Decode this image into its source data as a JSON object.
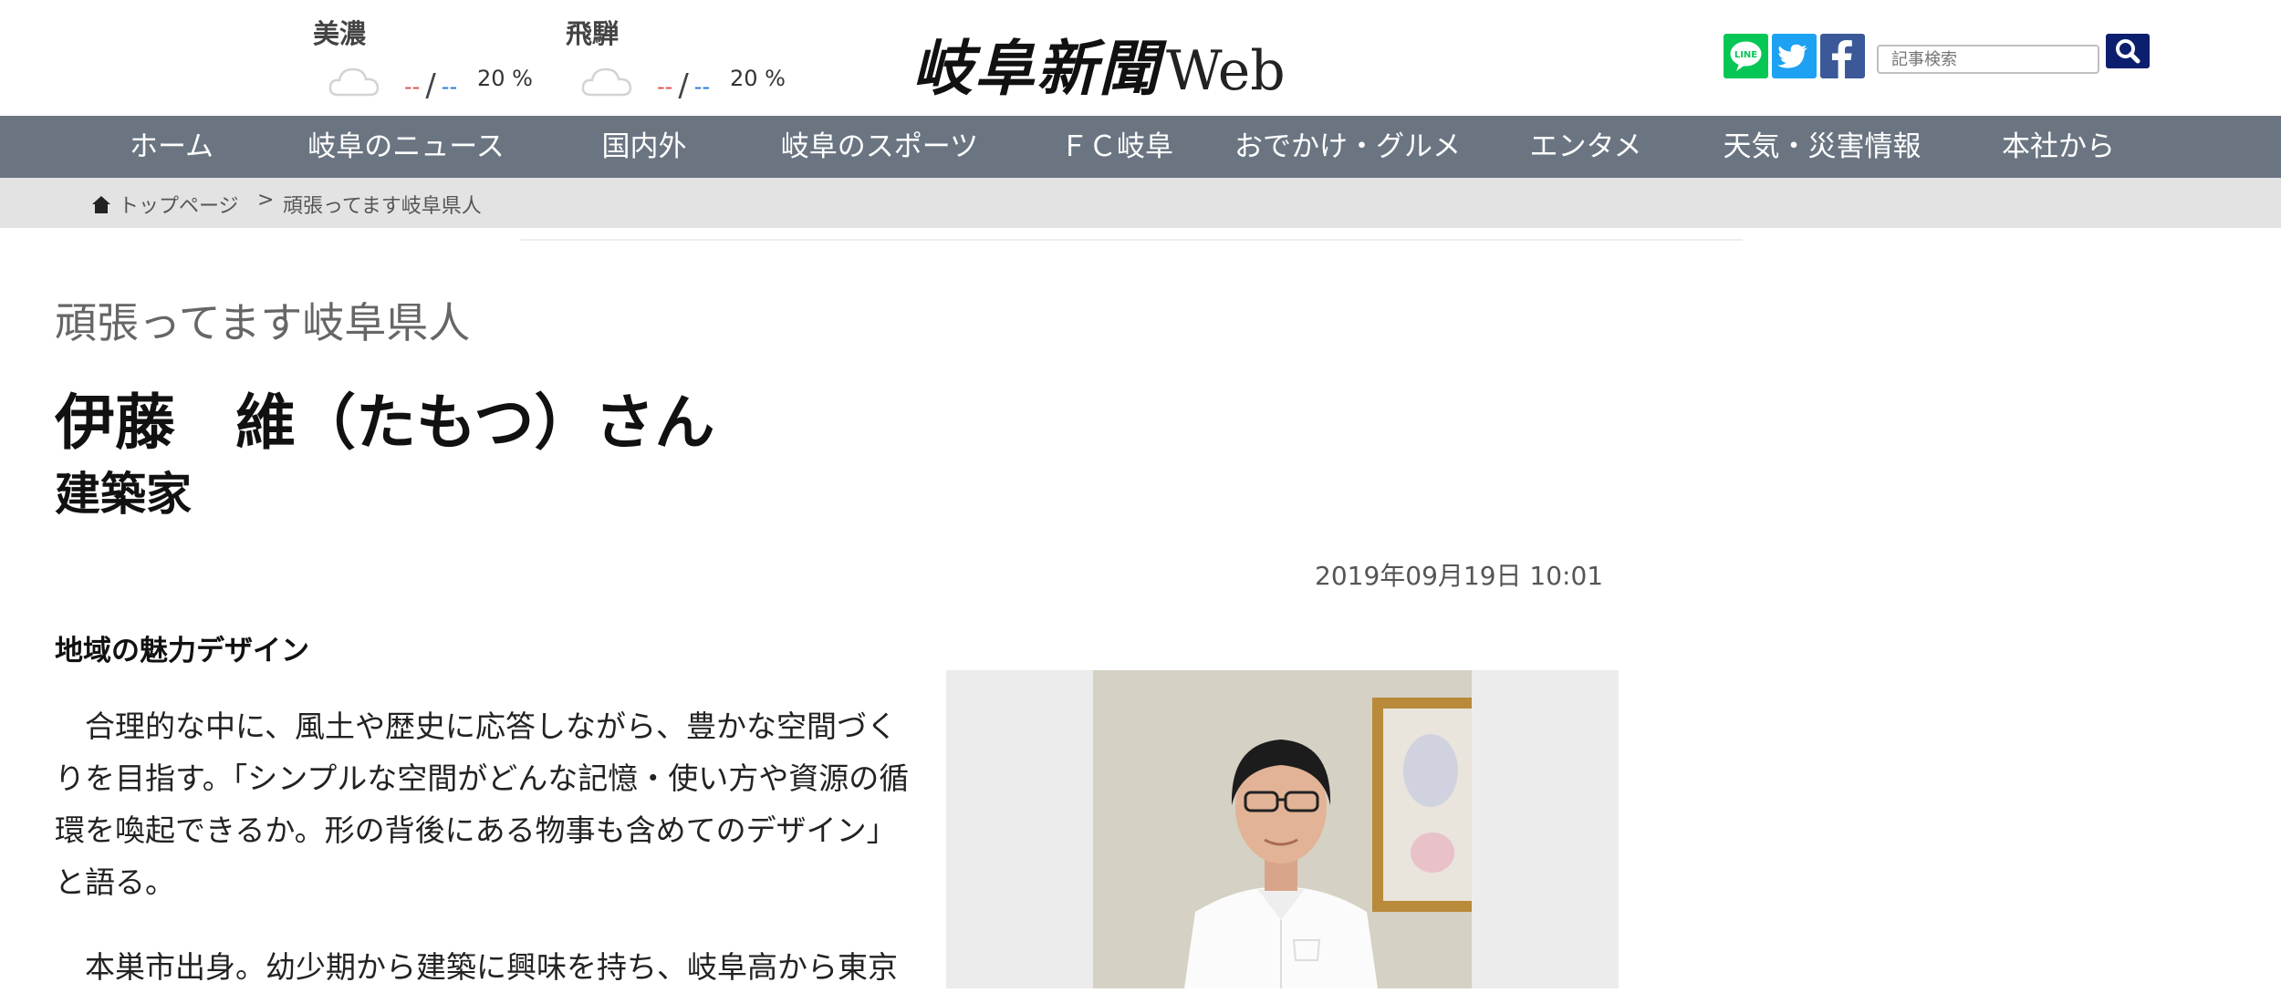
{
  "weather": [
    {
      "region": "美濃",
      "high": "--",
      "slash": "/",
      "low": "--",
      "rain": "20 %",
      "icon": "cloud-icon"
    },
    {
      "region": "飛騨",
      "high": "--",
      "slash": "/",
      "low": "--",
      "rain": "20 %",
      "icon": "cloud-icon"
    }
  ],
  "logo": {
    "main": "岐阜新聞",
    "suffix": "Web"
  },
  "sns": [
    {
      "name": "line-icon",
      "label": "LINE",
      "color": "#06c755"
    },
    {
      "name": "twitter-icon",
      "color": "#1da1f2"
    },
    {
      "name": "facebook-icon",
      "color": "#3b5998"
    }
  ],
  "search": {
    "placeholder": "記事検索",
    "button_icon": "search-icon",
    "button_color": "#0b1f6e"
  },
  "nav": [
    {
      "label": "ホーム"
    },
    {
      "label": "岐阜のニュース"
    },
    {
      "label": "国内外"
    },
    {
      "label": "岐阜のスポーツ"
    },
    {
      "label": "ＦＣ岐阜"
    },
    {
      "label": "おでかけ・グルメ"
    },
    {
      "label": "エンタメ"
    },
    {
      "label": "天気・災害情報"
    },
    {
      "label": "本社から"
    }
  ],
  "breadcrumb": {
    "home": "トップページ",
    "sep": ">",
    "current": "頑張ってます岐阜県人"
  },
  "article": {
    "category": "頑張ってます岐阜県人",
    "name": "伊藤　維（たもつ）さん",
    "occupation": "建築家",
    "date": "2019年09月19日 10:01",
    "subhead": "地域の魅力デザイン",
    "paragraphs": [
      "　合理的な中に、風土や歴史に応答しながら、豊かな空間づくりを目指す。「シンプルな空間がどんな記憶・使い方や資源の循環を喚起できるか。形の背後にある物事も含めてのデザイン」と語る。",
      "　本巣市出身。幼少期から建築に興味を持ち、岐阜高から東京"
    ]
  },
  "colors": {
    "nav_bg": "#6b7582",
    "breadcrumb_bg": "#e3e3e3",
    "photo_bg": "#ececec"
  }
}
